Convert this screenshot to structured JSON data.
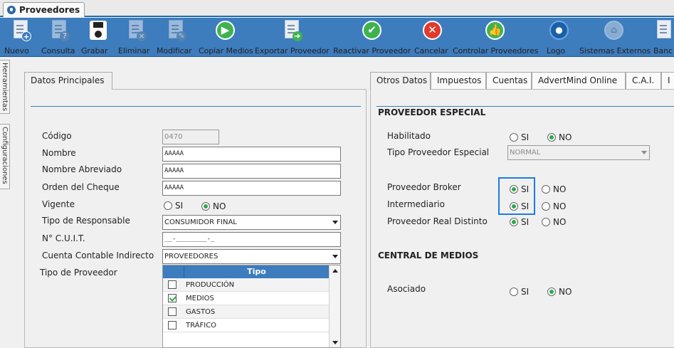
{
  "window_tab": {
    "title": "Proveedores"
  },
  "toolbar": [
    {
      "label": "Nuevo",
      "icon": "new-doc-icon",
      "enabled": true
    },
    {
      "label": "Consulta",
      "icon": "query-doc-icon",
      "enabled": false
    },
    {
      "label": "Grabar",
      "icon": "floppy-disk-icon",
      "enabled": true
    },
    {
      "label": "Eliminar",
      "icon": "delete-doc-icon",
      "enabled": false
    },
    {
      "label": "Modificar",
      "icon": "edit-doc-icon",
      "enabled": false
    },
    {
      "label": "Copiar Medios",
      "icon": "play-circle-icon",
      "enabled": true
    },
    {
      "label": "Exportar Proveedor",
      "icon": "export-doc-icon",
      "enabled": true
    },
    {
      "label": "Reactivar Proveedor",
      "icon": "check-circle-icon",
      "enabled": true
    },
    {
      "label": "Cancelar",
      "icon": "cancel-circle-icon",
      "enabled": true
    },
    {
      "label": "Controlar Proveedores",
      "icon": "thumbs-up-icon",
      "enabled": true
    },
    {
      "label": "Logo",
      "icon": "logo-icon",
      "enabled": true
    },
    {
      "label": "Sistemas Externos",
      "icon": "external-systems-icon",
      "enabled": false
    },
    {
      "label": "Banc",
      "icon": "bank-chart-icon",
      "enabled": true
    }
  ],
  "side_tabs": [
    "Herramientas",
    "Configuraciones"
  ],
  "left_panel": {
    "tab": "Datos Principales",
    "fields": {
      "codigo": {
        "label": "Código",
        "value": "0470"
      },
      "nombre": {
        "label": "Nombre",
        "value": "AAAAA"
      },
      "nombre_abreviado": {
        "label": "Nombre Abreviado",
        "value": "AAAAA"
      },
      "orden_cheque": {
        "label": "Orden del Cheque",
        "value": "AAAAA"
      },
      "vigente": {
        "label": "Vigente",
        "si": "SI",
        "no": "NO",
        "selected": "NO"
      },
      "tipo_responsable": {
        "label": "Tipo de Responsable",
        "value": "CONSUMIDOR FINAL"
      },
      "cuit": {
        "label": "N° C.U.I.T.",
        "value": "__-________-_"
      },
      "cuenta_contable": {
        "label": "Cuenta Contable Indirecto",
        "value": "PROVEEDORES"
      },
      "tipo_proveedor": {
        "label": "Tipo de Proveedor",
        "column": "Tipo",
        "items": [
          {
            "name": "PRODUCCIÓN",
            "checked": false
          },
          {
            "name": "MEDIOS",
            "checked": true
          },
          {
            "name": "GASTOS",
            "checked": false
          },
          {
            "name": "TRÁFICO",
            "checked": false
          }
        ]
      }
    }
  },
  "right_panel": {
    "tabs": [
      "Otros Datos",
      "Impuestos",
      "Cuentas",
      "AdvertMind Online",
      "C.A.I.",
      "I"
    ],
    "proveedor_especial": {
      "title": "PROVEEDOR ESPECIAL",
      "habilitado": {
        "label": "Habilitado",
        "si": "SI",
        "no": "NO",
        "selected": "NO"
      },
      "tipo_especial": {
        "label": "Tipo Proveedor Especial",
        "value": "NORMAL"
      },
      "broker": {
        "label": "Proveedor Broker",
        "si": "SI",
        "no": "NO",
        "selected": "SI"
      },
      "intermediario": {
        "label": "Intermediario",
        "si": "SI",
        "no": "NO",
        "selected": "SI"
      },
      "real_distinto": {
        "label": "Proveedor Real Distinto",
        "si": "SI",
        "no": "NO",
        "selected": "SI"
      }
    },
    "central_medios": {
      "title": "CENTRAL DE MEDIOS",
      "asociado": {
        "label": "Asociado",
        "si": "SI",
        "no": "NO",
        "selected": "NO"
      }
    }
  },
  "colors": {
    "toolbar": "#3d7cbd",
    "accent": "#1f6db0",
    "highlight": "#1e7be0",
    "check": "#2fa84f"
  }
}
